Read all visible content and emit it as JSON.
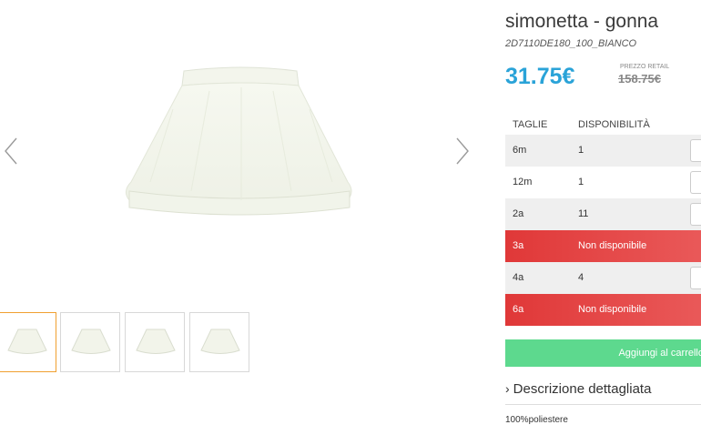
{
  "product": {
    "title": "simonetta - gonna",
    "sku": "2D7110DE180_100_BIANCO",
    "price": "31.75€",
    "retail_label": "PREZZO RETAIL",
    "retail_price": "158.75€"
  },
  "sizes_table": {
    "headers": [
      "TAGLIE",
      "DISPONIBILITÀ"
    ],
    "rows": [
      {
        "size": "6m",
        "availability": "1",
        "status": "available"
      },
      {
        "size": "12m",
        "availability": "1",
        "status": "available"
      },
      {
        "size": "2a",
        "availability": "11",
        "status": "available"
      },
      {
        "size": "3a",
        "availability": "Non disponibile",
        "status": "unavailable"
      },
      {
        "size": "4a",
        "availability": "4",
        "status": "available"
      },
      {
        "size": "6a",
        "availability": "Non disponibile",
        "status": "unavailable"
      }
    ]
  },
  "actions": {
    "add_to_cart": "Aggiungi al carrello"
  },
  "description": {
    "toggle_label": "Descrizione dettagliata",
    "text": "100%poliestere"
  },
  "gallery": {
    "thumbnail_count": 4,
    "active_thumbnail": 0,
    "prev_icon": "chevron-left-icon",
    "next_icon": "chevron-right-icon"
  },
  "colors": {
    "price": "#2aa3d8",
    "unavailable": "#e03838",
    "add_button": "#5dd98e",
    "active_thumb_border": "#f0a030"
  }
}
